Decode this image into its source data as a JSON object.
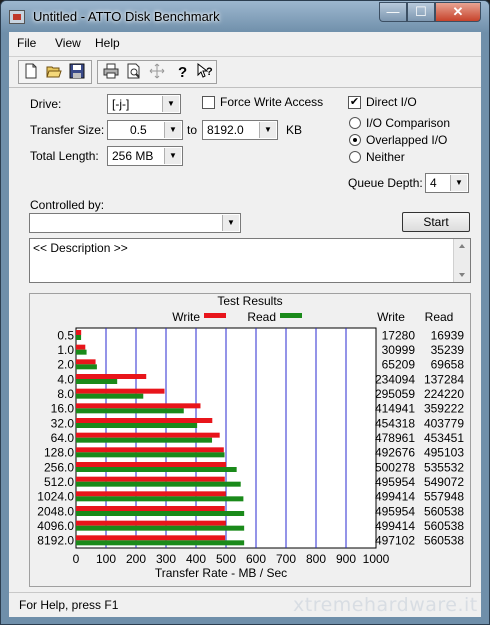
{
  "window": {
    "title": "Untitled - ATTO Disk Benchmark",
    "min": "—",
    "max": "☐",
    "close": "✕"
  },
  "menu": [
    "File",
    "View",
    "Help"
  ],
  "toolbar": [
    "new-icon",
    "open-icon",
    "save-icon",
    "print-icon",
    "print-preview-icon",
    "move-icon",
    "help-icon",
    "context-help-icon"
  ],
  "form": {
    "drive_label": "Drive:",
    "drive_value": "[-j-]",
    "force_write_label": "Force Write Access",
    "force_write_checked": false,
    "direct_io_label": "Direct I/O",
    "direct_io_checked": true,
    "transfer_size_label": "Transfer Size:",
    "transfer_from": "0.5",
    "transfer_to_label": "to",
    "transfer_to": "8192.0",
    "transfer_unit": "KB",
    "total_length_label": "Total Length:",
    "total_length_value": "256 MB",
    "io_comparison_label": "I/O Comparison",
    "overlapped_io_label": "Overlapped I/O",
    "neither_label": "Neither",
    "io_mode": "Overlapped I/O",
    "queue_depth_label": "Queue Depth:",
    "queue_depth_value": "4",
    "controlled_by_label": "Controlled by:",
    "controlled_by_value": "",
    "start_label": "Start",
    "description_text": "<< Description >>"
  },
  "results": {
    "title": "Test Results",
    "legend_write": "Write",
    "legend_read": "Read",
    "col_write": "Write",
    "col_read": "Read",
    "write_color": "#e8151b",
    "read_color": "#1a8a1a"
  },
  "chart_data": {
    "type": "bar",
    "orientation": "horizontal",
    "xlabel": "Transfer Rate - MB / Sec",
    "xlim": [
      0,
      1000
    ],
    "xticks": [
      0,
      100,
      200,
      300,
      400,
      500,
      600,
      700,
      800,
      900,
      1000
    ],
    "grid": true,
    "categories": [
      "0.5",
      "1.0",
      "2.0",
      "4.0",
      "8.0",
      "16.0",
      "32.0",
      "64.0",
      "128.0",
      "256.0",
      "512.0",
      "1024.0",
      "2048.0",
      "4096.0",
      "8192.0"
    ],
    "series": [
      {
        "name": "Write",
        "values": [
          17280,
          30999,
          65209,
          234094,
          295059,
          414941,
          454318,
          478961,
          492676,
          500278,
          495954,
          499414,
          495954,
          499414,
          497102
        ]
      },
      {
        "name": "Read",
        "values": [
          16939,
          35239,
          69658,
          137284,
          224220,
          359222,
          403779,
          453451,
          495103,
          535532,
          549072,
          557948,
          560538,
          560538,
          560538
        ]
      }
    ]
  },
  "status": {
    "text": "For Help, press F1",
    "watermark": "xtremehardware.it"
  }
}
